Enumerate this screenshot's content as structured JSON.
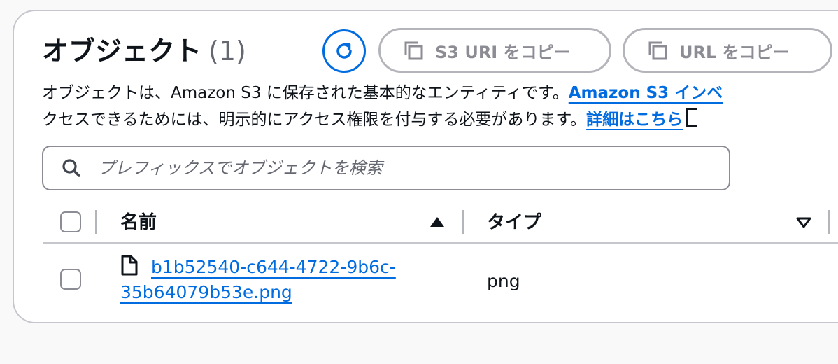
{
  "header": {
    "title": "オブジェクト",
    "count": "(1)",
    "copy_s3_uri_label": "S3 URI をコピー",
    "copy_url_label": "URL をコピー"
  },
  "description": {
    "line1_text": "オブジェクトは、Amazon S3 に保存された基本的なエンティティです。",
    "line1_link": "Amazon S3 インベ",
    "line2_text": "クセスできるためには、明示的にアクセス権限を付与する必要があります。",
    "line2_link": "詳細はこちら"
  },
  "search": {
    "placeholder": "プレフィックスでオブジェクトを検索",
    "value": ""
  },
  "table": {
    "columns": {
      "name": "名前",
      "type": "タイプ"
    },
    "rows": [
      {
        "name": "b1b52540-c644-4722-9b6c-35b64079b53e.png",
        "type": "png"
      }
    ]
  },
  "colors": {
    "accent": "#006ce0",
    "text": "#0f141a",
    "muted": "#656871",
    "border": "#c6c6cd"
  },
  "icons": {
    "refresh": "refresh-icon",
    "copy": "copy-icon",
    "search": "search-icon",
    "external": "external-link-icon",
    "file": "file-icon",
    "sort_asc": "sort-ascending-icon",
    "sort_desc": "sort-descending-icon"
  }
}
